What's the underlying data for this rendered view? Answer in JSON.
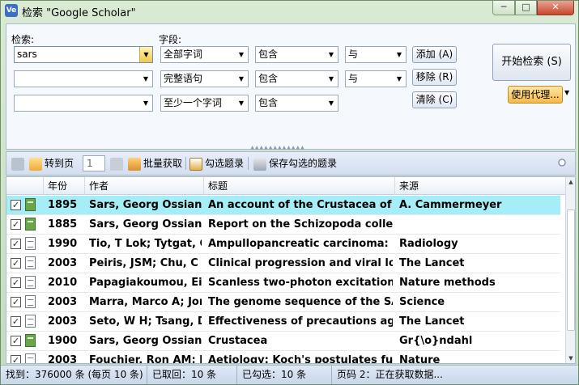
{
  "window": {
    "title": "检索 \"Google Scholar\"",
    "icon_text": "Ve"
  },
  "search": {
    "search_label": "检索:",
    "field_label": "字段:",
    "rows": [
      {
        "term": "sars",
        "field": "全部字词",
        "op": "包含",
        "logic": "与"
      },
      {
        "term": "",
        "field": "完整语句",
        "op": "包含",
        "logic": "与"
      },
      {
        "term": "",
        "field": "至少一个字词",
        "op": "包含"
      }
    ],
    "add_button": "添加 (A)",
    "remove_button": "移除 (R)",
    "clear_button": "清除 (C)",
    "start_button": "开始检索 (S)",
    "proxy_button": "使用代理..."
  },
  "toolbar": {
    "goto_page": "转到页",
    "page_value": "1",
    "batch_fetch": "批量获取",
    "check_records": "勾选题录",
    "save_checked": "保存勾选的题录"
  },
  "table": {
    "columns": [
      "年份",
      "作者",
      "标题",
      "来源"
    ],
    "rows": [
      {
        "checked": true,
        "kind": "book",
        "year": "1895",
        "author": "Sars, Georg Ossian",
        "title": "An account of the Crustacea of N.",
        "source": "A. Cammermeyer",
        "selected": true
      },
      {
        "checked": true,
        "kind": "book",
        "year": "1885",
        "author": "Sars, Georg Ossian",
        "title": "Report on the Schizopoda collect",
        "source": ""
      },
      {
        "checked": true,
        "kind": "paper",
        "year": "1990",
        "author": "Tio, T Lok; Tytgat, G",
        "title": "Ampullopancreatic carcinoma: pr",
        "source": "Radiology"
      },
      {
        "checked": true,
        "kind": "paper",
        "year": "2003",
        "author": "Peiris, JSM; Chu, C ..",
        "title": "Clinical progression and viral load",
        "source": "The Lancet"
      },
      {
        "checked": true,
        "kind": "paper",
        "year": "2010",
        "author": "Papagiakoumou, Eir",
        "title": "Scanless two-photon excitation of",
        "source": "Nature methods"
      },
      {
        "checked": true,
        "kind": "paper",
        "year": "2003",
        "author": "Marra, Marco A; Jor",
        "title": "The genome sequence of the SAR",
        "source": "Science"
      },
      {
        "checked": true,
        "kind": "paper",
        "year": "2003",
        "author": "Seto, W H; Tsang, D;",
        "title": "Effectiveness of precautions again",
        "source": "The Lancet"
      },
      {
        "checked": true,
        "kind": "book",
        "year": "1900",
        "author": "Sars, Georg Ossian",
        "title": "Crustacea",
        "source": "Gr{\\o}ndahl"
      },
      {
        "checked": true,
        "kind": "paper",
        "year": "2003",
        "author": "Fouchier, Ron AM; K",
        "title": "Aetiology: Koch's postulates fulfil",
        "source": "Nature"
      }
    ]
  },
  "status": {
    "found": "找到：376000 条 (每页 10 条)",
    "fetched": "已取回：10 条",
    "checked": "已勾选：10 条",
    "page": "页码 2：正在获取数据..."
  }
}
